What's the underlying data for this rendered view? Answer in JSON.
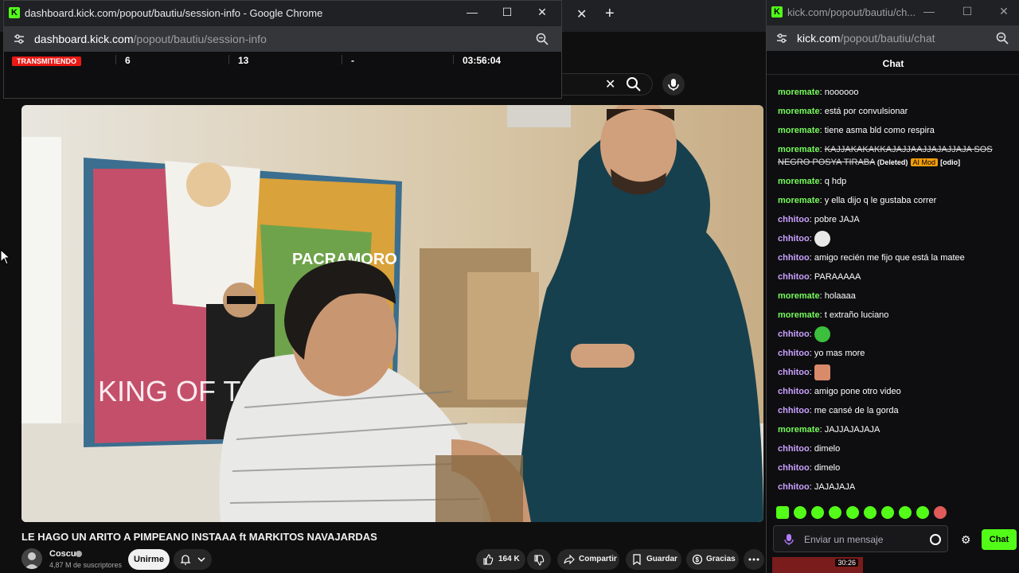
{
  "left_window": {
    "title": "dashboard.kick.com/popout/bautiu/session-info - Google Chrome",
    "url_domain": "dashboard.kick.com",
    "url_path": "/popout/bautiu/session-info",
    "live_badge": "TRANSMITIENDO",
    "stats": [
      "6",
      "13",
      "-",
      "03:56:04"
    ]
  },
  "video": {
    "title": "LE HAGO UN ARITO A PIMPEANO INSTAAA ft MARKITOS NAVAJARDAS",
    "poster_text": "KING OF THE",
    "channel": "Coscu",
    "subscribers": "4,87 M de suscriptores",
    "join_label": "Unirme",
    "likes": "164 K",
    "share_label": "Compartir",
    "save_label": "Guardar",
    "thanks_label": "Gracias"
  },
  "chat_window": {
    "title": "kick.com/popout/bautiu/ch...",
    "url_domain": "kick.com",
    "url_path": "/popout/bautiu/chat",
    "header": "Chat",
    "messages": [
      {
        "user": "moremate",
        "text": "noooooo",
        "color": "green"
      },
      {
        "user": "moremate",
        "text": "está por convulsionar",
        "color": "green"
      },
      {
        "user": "moremate",
        "text": "tiene asma bld como respira",
        "color": "green"
      },
      {
        "user": "moremate",
        "text": "KAJJAKAKAKKAJAJJAAJJAJAJJAJA SOS NEGRO POSYA TIRABA",
        "deleted_tag": "(Deleted)",
        "mod_tag": "AI Mod",
        "odio_tag": "[odio]",
        "color": "green"
      },
      {
        "user": "moremate",
        "text": "q hdp",
        "color": "green"
      },
      {
        "user": "moremate",
        "text": "y ella dijo q le gustaba correr",
        "color": "green"
      },
      {
        "user": "chhitoo",
        "text": "pobre JAJA",
        "color": "purple"
      },
      {
        "user": "chhitoo",
        "text": "",
        "color": "purple"
      },
      {
        "user": "chhitoo",
        "text": "amigo recién me fijo que está la matee",
        "color": "purple"
      },
      {
        "user": "chhitoo",
        "text": "PARAAAAA",
        "color": "purple"
      },
      {
        "user": "moremate",
        "text": "holaaaa",
        "color": "green"
      },
      {
        "user": "moremate",
        "text": "t extraño luciano",
        "color": "green"
      },
      {
        "user": "chhitoo",
        "text": "",
        "color": "purple"
      },
      {
        "user": "chhitoo",
        "text": "yo mas more",
        "color": "purple"
      },
      {
        "user": "chhitoo",
        "text": "",
        "color": "purple"
      },
      {
        "user": "chhitoo",
        "text": "amigo pone otro video",
        "color": "purple"
      },
      {
        "user": "chhitoo",
        "text": "me cansé de la gorda",
        "color": "purple"
      },
      {
        "user": "moremate",
        "text": "JAJJAJAJAJA",
        "color": "green"
      },
      {
        "user": "chhitoo",
        "text": "dimelo",
        "color": "purple"
      },
      {
        "user": "chhitoo",
        "text": "dimelo",
        "color": "purple"
      },
      {
        "user": "chhitoo",
        "text": "JAJAJAJA",
        "color": "purple"
      }
    ],
    "input_placeholder": "Enviar un mensaje",
    "send_label": "Chat"
  },
  "thumb_time": "30:26",
  "colors": {
    "kick_green": "#53fc18",
    "live_red": "#e91916",
    "ai_mod": "#f59e0b"
  }
}
